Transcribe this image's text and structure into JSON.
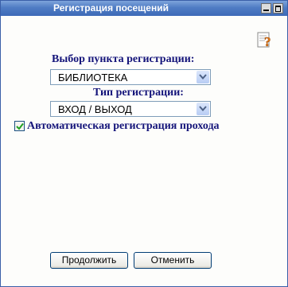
{
  "window": {
    "title": "Регистрация посещений"
  },
  "form": {
    "point_label": "Выбор пункта регистрации:",
    "point_value": "БИБЛИОТЕКА",
    "type_label": "Тип регистрации:",
    "type_value": "ВХОД / ВЫХОД",
    "auto_label": "Автоматическая регистрация прохода",
    "auto_checked": true
  },
  "buttons": {
    "continue_label": "Продолжить",
    "cancel_label": "Отменить"
  },
  "icons": {
    "help": "help-icon",
    "minimize": "minimize-icon",
    "maximize": "maximize-icon",
    "dropdown": "chevron-down-icon",
    "check": "checkmark-icon"
  }
}
